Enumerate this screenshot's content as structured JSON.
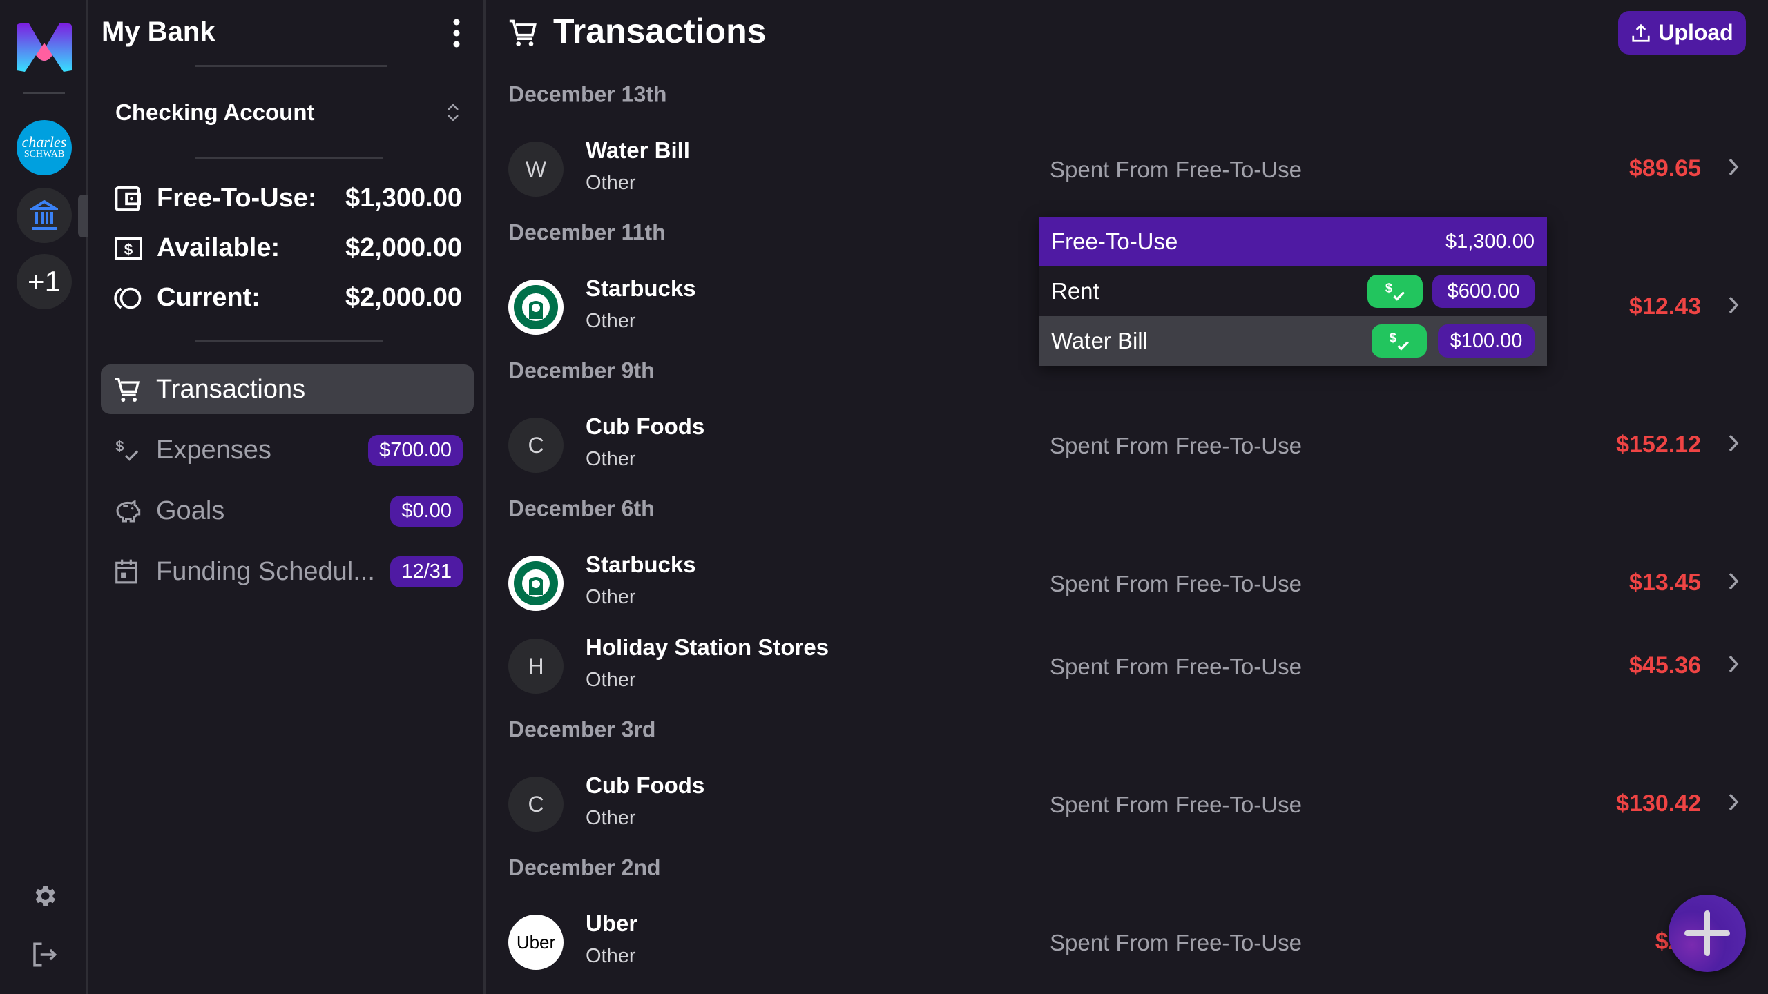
{
  "app": {
    "title": "My Bank",
    "account": "Checking Account"
  },
  "rail": {
    "bank_logo_line1": "charles",
    "bank_logo_line2": "SCHWAB",
    "add_label": "+1"
  },
  "balances": [
    {
      "label": "Free-To-Use:",
      "value": "$1,300.00",
      "icon": "wallet-icon"
    },
    {
      "label": "Available:",
      "value": "$2,000.00",
      "icon": "dollar-bill-icon"
    },
    {
      "label": "Current:",
      "value": "$2,000.00",
      "icon": "coins-icon"
    }
  ],
  "nav": [
    {
      "label": "Transactions",
      "icon": "cart-icon",
      "active": true
    },
    {
      "label": "Expenses",
      "icon": "dollar-check-icon",
      "badge": "$700.00"
    },
    {
      "label": "Goals",
      "icon": "piggy-bank-icon",
      "badge": "$0.00"
    },
    {
      "label": "Funding Schedul...",
      "icon": "calendar-icon",
      "badge": "12/31"
    }
  ],
  "header": {
    "title": "Transactions",
    "upload_label": "Upload"
  },
  "dates": [
    "December 13th",
    "December 11th",
    "December 9th",
    "December 6th",
    "December 3rd",
    "December 2nd"
  ],
  "transactions": [
    {
      "avatar": "W",
      "name": "Water Bill",
      "category": "Other",
      "source": "Spent From Free-To-Use",
      "amount": "$89.65"
    },
    {
      "avatar": "starbucks",
      "name": "Starbucks",
      "category": "Other",
      "source": "",
      "amount": "$12.43"
    },
    {
      "avatar": "C",
      "name": "Cub Foods",
      "category": "Other",
      "source": "Spent From Free-To-Use",
      "amount": "$152.12"
    },
    {
      "avatar": "starbucks",
      "name": "Starbucks",
      "category": "Other",
      "source": "Spent From Free-To-Use",
      "amount": "$13.45"
    },
    {
      "avatar": "H",
      "name": "Holiday Station Stores",
      "category": "Other",
      "source": "Spent From Free-To-Use",
      "amount": "$45.36"
    },
    {
      "avatar": "C",
      "name": "Cub Foods",
      "category": "Other",
      "source": "Spent From Free-To-Use",
      "amount": "$130.42"
    },
    {
      "avatar": "Uber",
      "name": "Uber",
      "category": "Other",
      "source": "Spent From Free-To-Use",
      "amount": "$23."
    }
  ],
  "popup": {
    "header": {
      "label": "Free-To-Use",
      "value": "$1,300.00"
    },
    "items": [
      {
        "label": "Rent",
        "value": "$600.00"
      },
      {
        "label": "Water Bill",
        "value": "$100.00"
      }
    ]
  },
  "colors": {
    "accent": "#4f1aa3",
    "negative": "#ef4444",
    "success": "#22c55e",
    "background": "#1b1921"
  }
}
